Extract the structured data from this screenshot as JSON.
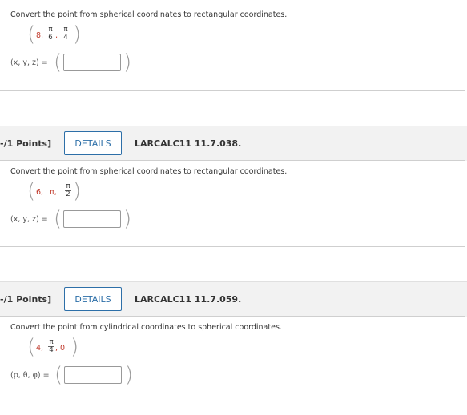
{
  "problems": [
    {
      "instruction": "Convert the point from spherical coordinates to rectangular coordinates.",
      "point": {
        "first": "8,",
        "frac1_num": "π",
        "frac1_den": "6",
        "sep": ",",
        "frac2_num": "π",
        "frac2_den": "4"
      },
      "answer_label": "(x, y, z) =",
      "answer_value": ""
    },
    {
      "points_label": "-/1 Points]",
      "details_label": "DETAILS",
      "code": "LARCALC11 11.7.038.",
      "instruction": "Convert the point from spherical coordinates to rectangular coordinates.",
      "point": {
        "first": "6,",
        "second": "π,",
        "frac1_num": "π",
        "frac1_den": "2"
      },
      "answer_label": "(x, y, z) =",
      "answer_value": ""
    },
    {
      "points_label": "-/1 Points]",
      "details_label": "DETAILS",
      "code": "LARCALC11 11.7.059.",
      "instruction": "Convert the point from cylindrical coordinates to spherical coordinates.",
      "point": {
        "first": "4,",
        "frac1_num": "π",
        "frac1_den": "4",
        "last": ", 0"
      },
      "answer_label": "(ρ, θ, φ) =",
      "answer_value": ""
    }
  ],
  "colors": {
    "accent": "#2d6fa8",
    "point": "#c0392b"
  }
}
